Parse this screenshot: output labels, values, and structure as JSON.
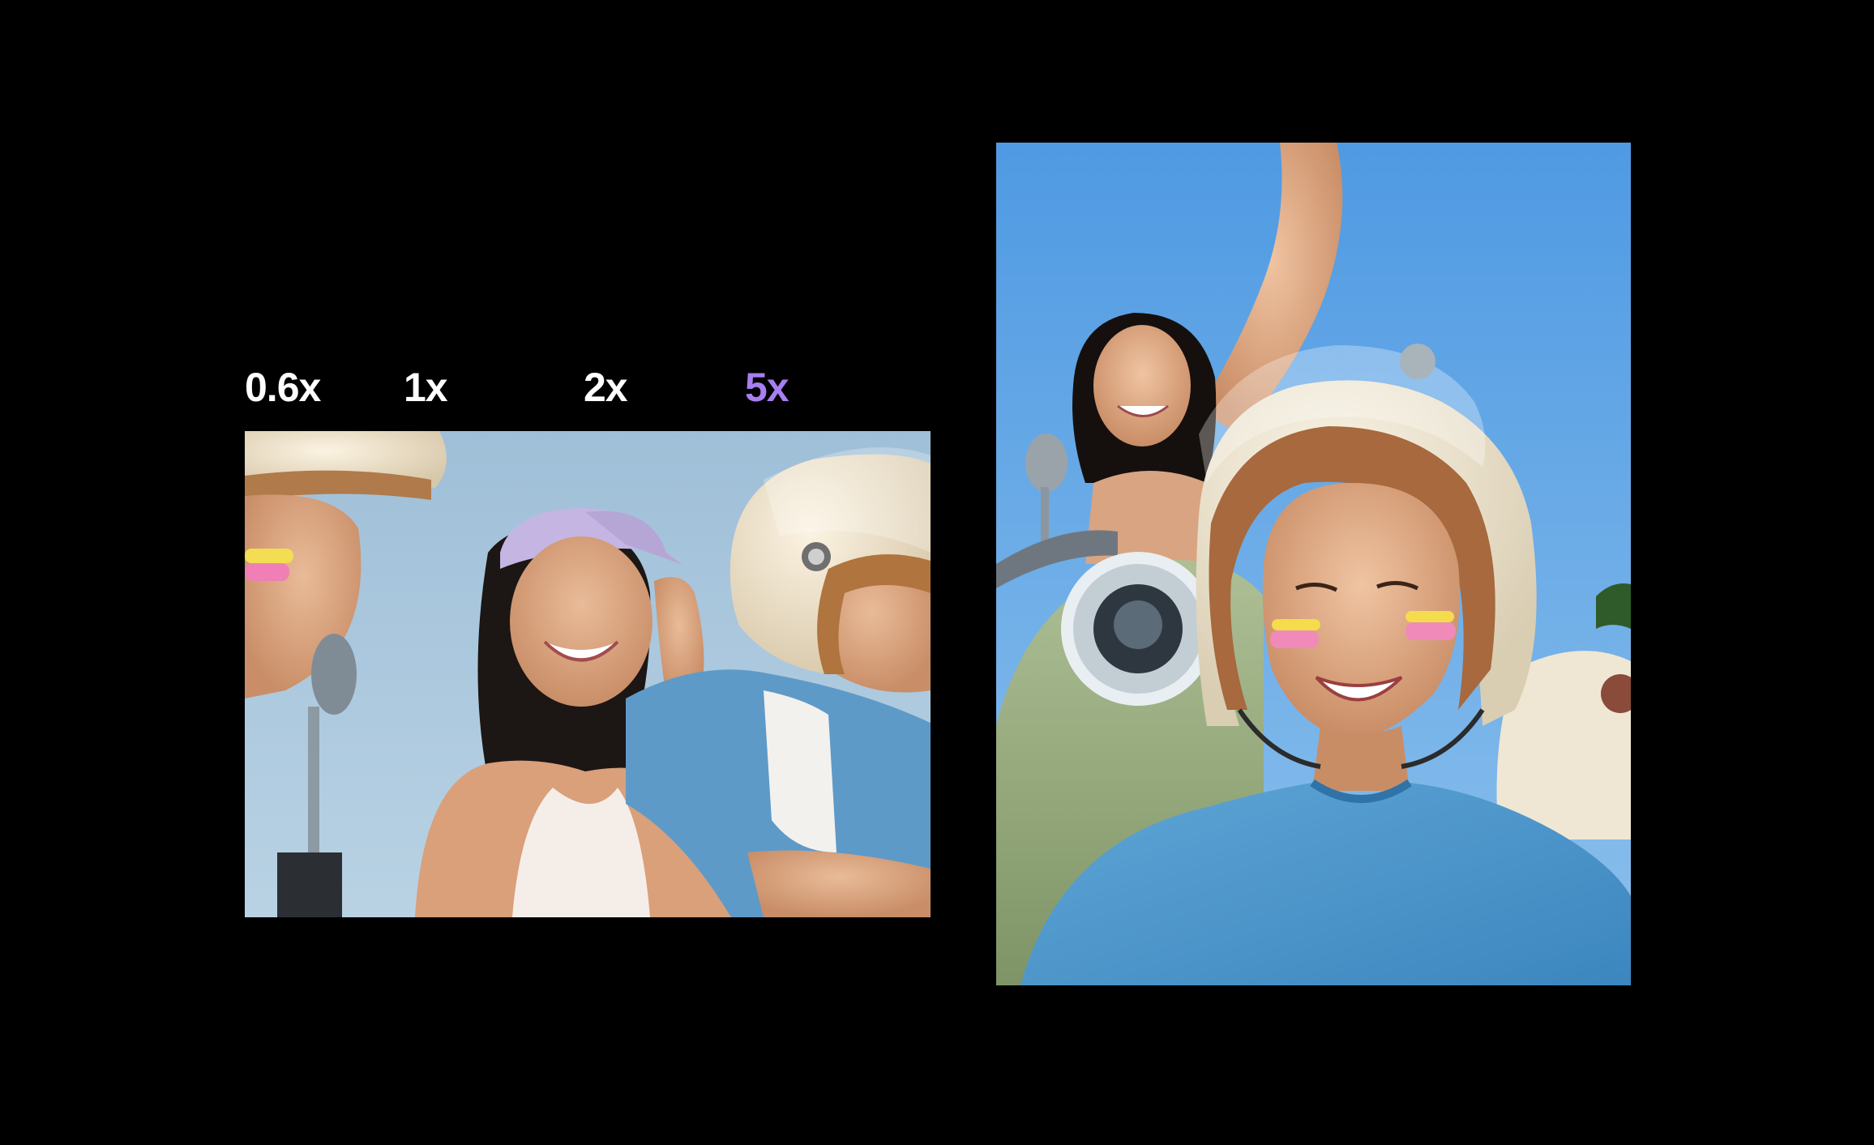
{
  "zoom_selector": {
    "options": [
      {
        "label": "0.6x",
        "active": false
      },
      {
        "label": "1x",
        "active": false
      },
      {
        "label": "2x",
        "active": false
      },
      {
        "label": "5x",
        "active": true
      }
    ],
    "active_color": "#a77ff0",
    "inactive_color": "#ffffff"
  },
  "photos": {
    "left": {
      "description_icon": "group-scooter-photo"
    },
    "right": {
      "description_icon": "selfie-scooter-photo"
    }
  },
  "colors": {
    "background": "#000000",
    "sky": "#a9c7e0",
    "sky_deep": "#5ea3e3"
  }
}
